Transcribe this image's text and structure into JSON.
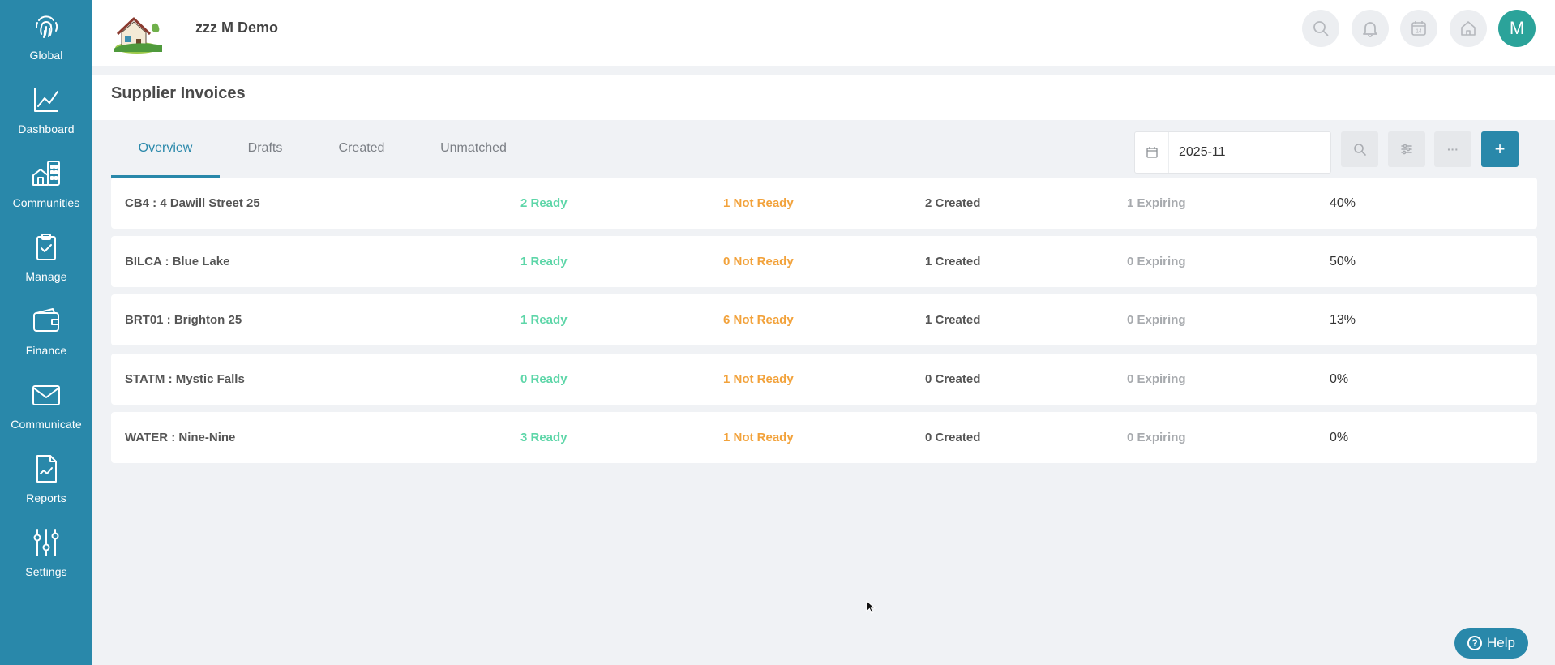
{
  "sidebar": {
    "items": [
      {
        "label": "Global",
        "icon": "fingerprint-icon"
      },
      {
        "label": "Dashboard",
        "icon": "line-chart-icon"
      },
      {
        "label": "Communities",
        "icon": "buildings-icon"
      },
      {
        "label": "Manage",
        "icon": "clipboard-check-icon"
      },
      {
        "label": "Finance",
        "icon": "wallet-icon"
      },
      {
        "label": "Communicate",
        "icon": "envelope-icon"
      },
      {
        "label": "Reports",
        "icon": "report-document-icon"
      },
      {
        "label": "Settings",
        "icon": "sliders-icon"
      }
    ]
  },
  "header": {
    "org_name": "zzz M Demo",
    "avatar_initial": "M",
    "calendar_day": "14"
  },
  "page": {
    "title": "Supplier Invoices"
  },
  "tabs": [
    {
      "label": "Overview",
      "active": true
    },
    {
      "label": "Drafts",
      "active": false
    },
    {
      "label": "Created",
      "active": false
    },
    {
      "label": "Unmatched",
      "active": false
    }
  ],
  "toolbar": {
    "date_value": "2025-11",
    "more_label": "···",
    "add_label": "+"
  },
  "rows": [
    {
      "name": "CB4 : 4 Dawill Street 25",
      "ready": "2 Ready",
      "not_ready": "1 Not Ready",
      "created": "2 Created",
      "expiring": "1 Expiring",
      "percent": "40%"
    },
    {
      "name": "BILCA : Blue Lake",
      "ready": "1 Ready",
      "not_ready": "0 Not Ready",
      "created": "1 Created",
      "expiring": "0 Expiring",
      "percent": "50%"
    },
    {
      "name": "BRT01 : Brighton 25",
      "ready": "1 Ready",
      "not_ready": "6 Not Ready",
      "created": "1 Created",
      "expiring": "0 Expiring",
      "percent": "13%"
    },
    {
      "name": "STATM : Mystic Falls",
      "ready": "0 Ready",
      "not_ready": "1 Not Ready",
      "created": "0 Created",
      "expiring": "0 Expiring",
      "percent": "0%"
    },
    {
      "name": "WATER : Nine-Nine",
      "ready": "3 Ready",
      "not_ready": "1 Not Ready",
      "created": "0 Created",
      "expiring": "0 Expiring",
      "percent": "0%"
    }
  ],
  "help": {
    "label": "Help",
    "icon_glyph": "?"
  },
  "colors": {
    "brand": "#2988aa",
    "ready": "#5dd6a8",
    "not_ready": "#f2a23b",
    "expiring": "#a7aaae",
    "avatar": "#2ba39a"
  }
}
